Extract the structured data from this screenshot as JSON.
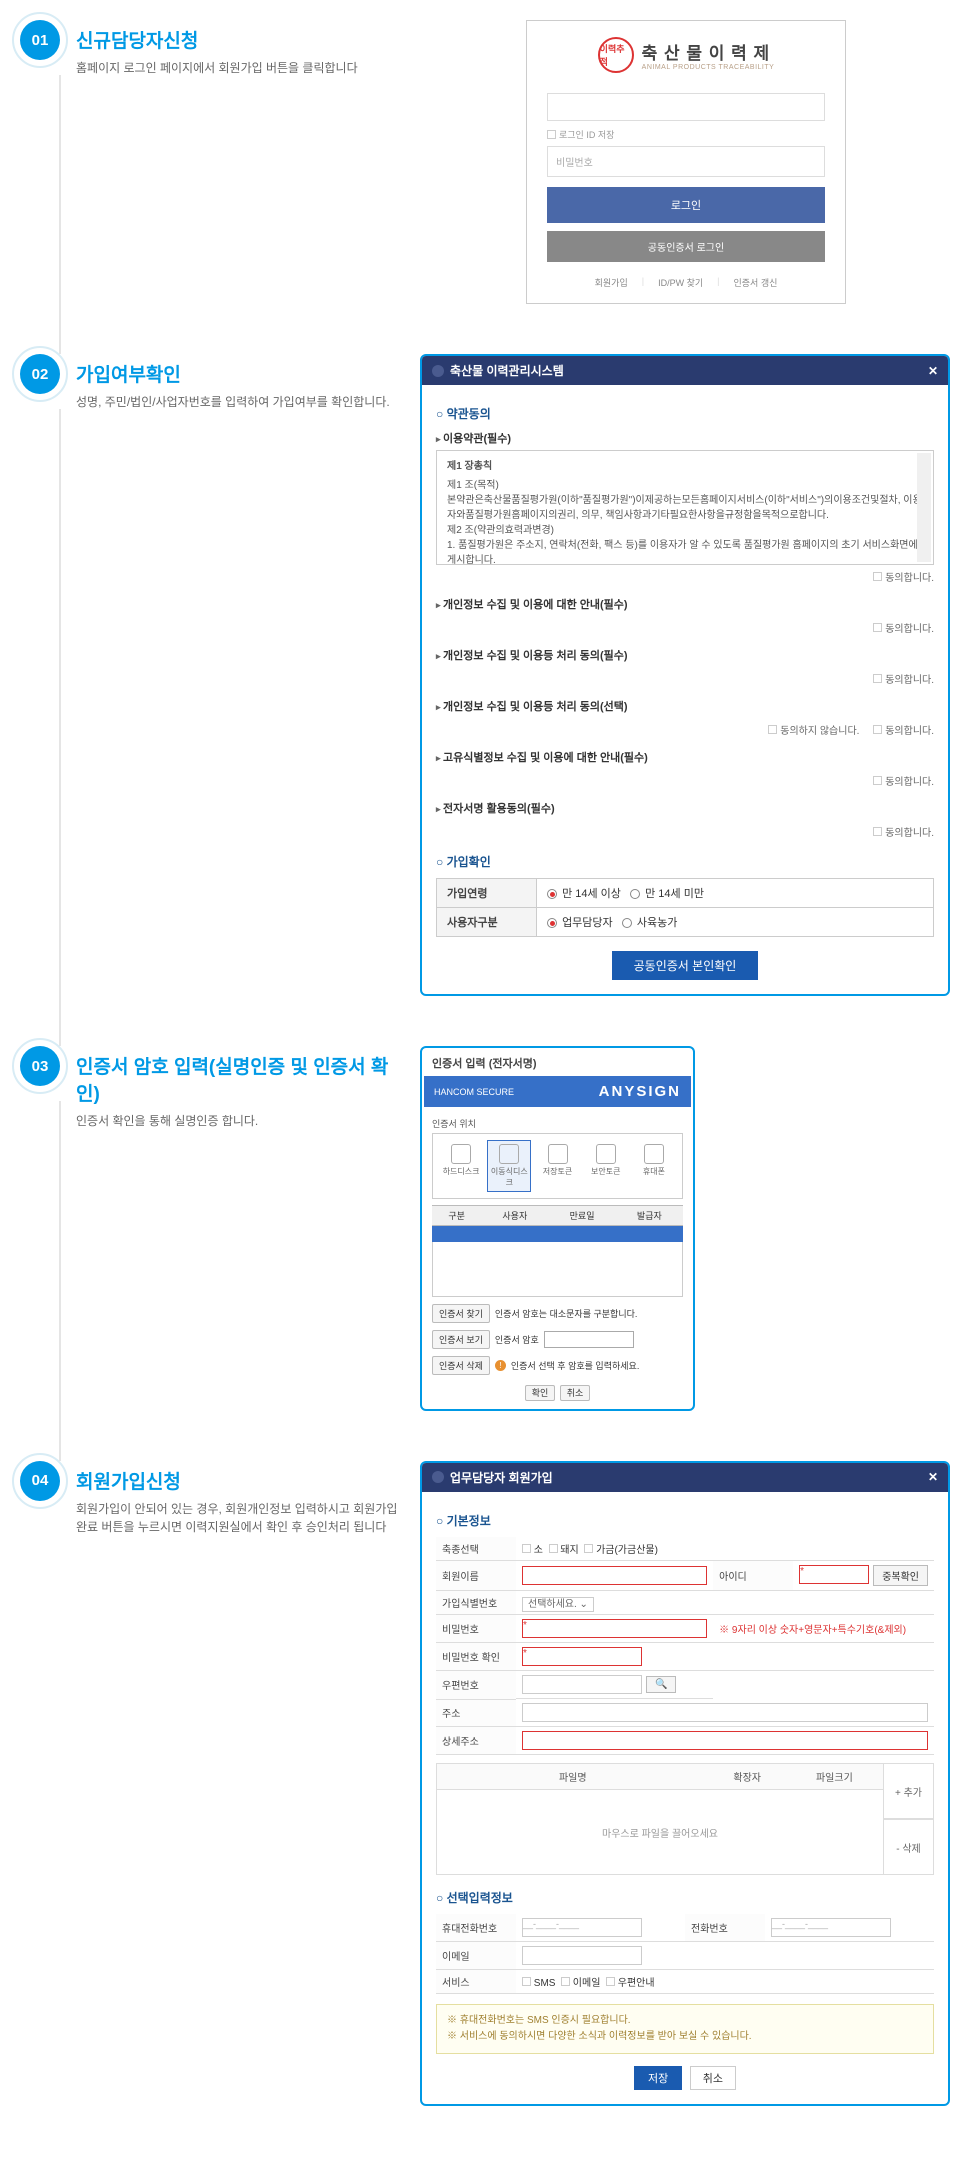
{
  "steps": {
    "s1": {
      "num": "01",
      "title": "신규담당자신청",
      "desc": "홈페이지 로그인 페이지에서 회원가입 버튼을 클릭합니다"
    },
    "s2": {
      "num": "02",
      "title": "가입여부확인",
      "desc": "성명, 주민/법인/사업자번호를 입력하여 가입여부를 확인합니다."
    },
    "s3": {
      "num": "03",
      "title": "인증서 암호 입력(실명인증 및 인증서 확인)",
      "desc": "인증서 확인을 통해 실명인증 합니다."
    },
    "s4": {
      "num": "04",
      "title": "회원가입신청",
      "desc": "회원가입이 안되어 있는 경우, 회원개인정보 입력하시고 회원가입 완료 버튼을 누르시면 이력지원실에서 확인 후 승인처리 됩니다"
    }
  },
  "login": {
    "logo_kr": "축 산 물 이 력 제",
    "logo_en": "ANIMAL PRODUCTS TRACEABILITY",
    "logo_badge": "이력추적",
    "save_id": "로그인 ID 저장",
    "pw_placeholder": "비밀번호",
    "btn_login": "로그인",
    "btn_cert": "공동인증서 로그인",
    "link1": "회원가입",
    "link2": "ID/PW 찾기",
    "link3": "인증서 갱신"
  },
  "terms": {
    "header": "축산물 이력관리시스템",
    "sec1": "약관동의",
    "sub1": "이용약관(필수)",
    "box_title": "제1 장총칙",
    "box_body1": "제1 조(목적)",
    "box_body2": "본약관은축산물품질평가원(이하\"품질평가원\")이제공하는모든홈페이지서비스(이하\"서비스\")의이용조건및절차, 이용자와품질평가원홈페이지의권리, 의무, 책임사항과기타필요한사항을규정함을목적으로합니다.",
    "box_body3": "제2 조(약관의효력과변경)",
    "box_body4": "1. 품질평가원은 주소지, 연락처(전화, 팩스 등)를 이용자가 알 수 있도록 품질평가원 홈페이지의 초기 서비스화면에 게시합니다.",
    "agree": "동의합니다.",
    "sub2": "개인정보 수집 및 이용에 대한 안내(필수)",
    "sub3": "개인정보 수집 및 이용등 처리 동의(필수)",
    "sub4": "개인정보 수집 및 이용등 처리 동의(선택)",
    "disagree": "동의하지 않습니다.",
    "sub5": "고유식별정보 수집 및 이용에 대한 안내(필수)",
    "sub6": "전자서명 활용동의(필수)",
    "sec2": "가입확인",
    "row1": "가입연령",
    "opt1a": "만 14세 이상",
    "opt1b": "만 14세 미만",
    "row2": "사용자구분",
    "opt2a": "업무담당자",
    "opt2b": "사육농가",
    "btn_confirm": "공동인증서 본인확인"
  },
  "cert": {
    "title": "인증서 입력 (전자서명)",
    "brand_left": "HANCOM SECURE",
    "brand_right": "ANYSIGN",
    "loc_label": "인증서 위치",
    "loc1": "하드디스크",
    "loc2": "이동식디스크",
    "loc3": "저장토큰",
    "loc4": "보안토큰",
    "loc5": "휴대폰",
    "th1": "구분",
    "th2": "사용자",
    "th3": "만료일",
    "th4": "발급자",
    "btn_find": "인증서 찾기",
    "note1": "인증서 암호는 대소문자를 구분합니다.",
    "btn_view": "인증서 보기",
    "pw_label": "인증서 암호",
    "btn_del": "인증서 삭제",
    "note2": "인증서 선택 후 암호를 입력하세요.",
    "btn_ok": "확인",
    "btn_cancel": "취소"
  },
  "form": {
    "header": "업무담당자 회원가입",
    "sec1": "기본정보",
    "f_species": "축종선택",
    "sp1": "소",
    "sp2": "돼지",
    "sp3": "가금(가금산물)",
    "f_name": "회원이름",
    "f_id": "아이디",
    "dup": "중복확인",
    "f_regno": "가입식별번호",
    "sel_default": "선택하세요.",
    "f_pw": "비밀번호",
    "pw_hint": "※ 9자리 이상 숫자+영문자+특수기호(&제외)",
    "f_pw2": "비밀번호 확인",
    "f_zip": "우편번호",
    "f_addr": "주소",
    "f_addr2": "상세주소",
    "file_h1": "파일명",
    "file_h2": "확장자",
    "file_h3": "파일크기",
    "file_drop": "마우스로 파일을 끌어오세요",
    "file_add": "+ 추가",
    "file_del": "- 삭제",
    "sec2": "선택입력정보",
    "f_mobile": "휴대전화번호",
    "f_tel": "전화번호",
    "f_email": "이메일",
    "f_svc": "서비스",
    "svc1": "SMS",
    "svc2": "이메일",
    "svc3": "우편안내",
    "note1": "※ 휴대전화번호는 SMS 인증시 필요합니다.",
    "note2": "※ 서비스에 동의하시면 다양한 소식과 이력정보를 받아 보실 수 있습니다.",
    "btn_save": "저장",
    "btn_cancel": "취소"
  }
}
